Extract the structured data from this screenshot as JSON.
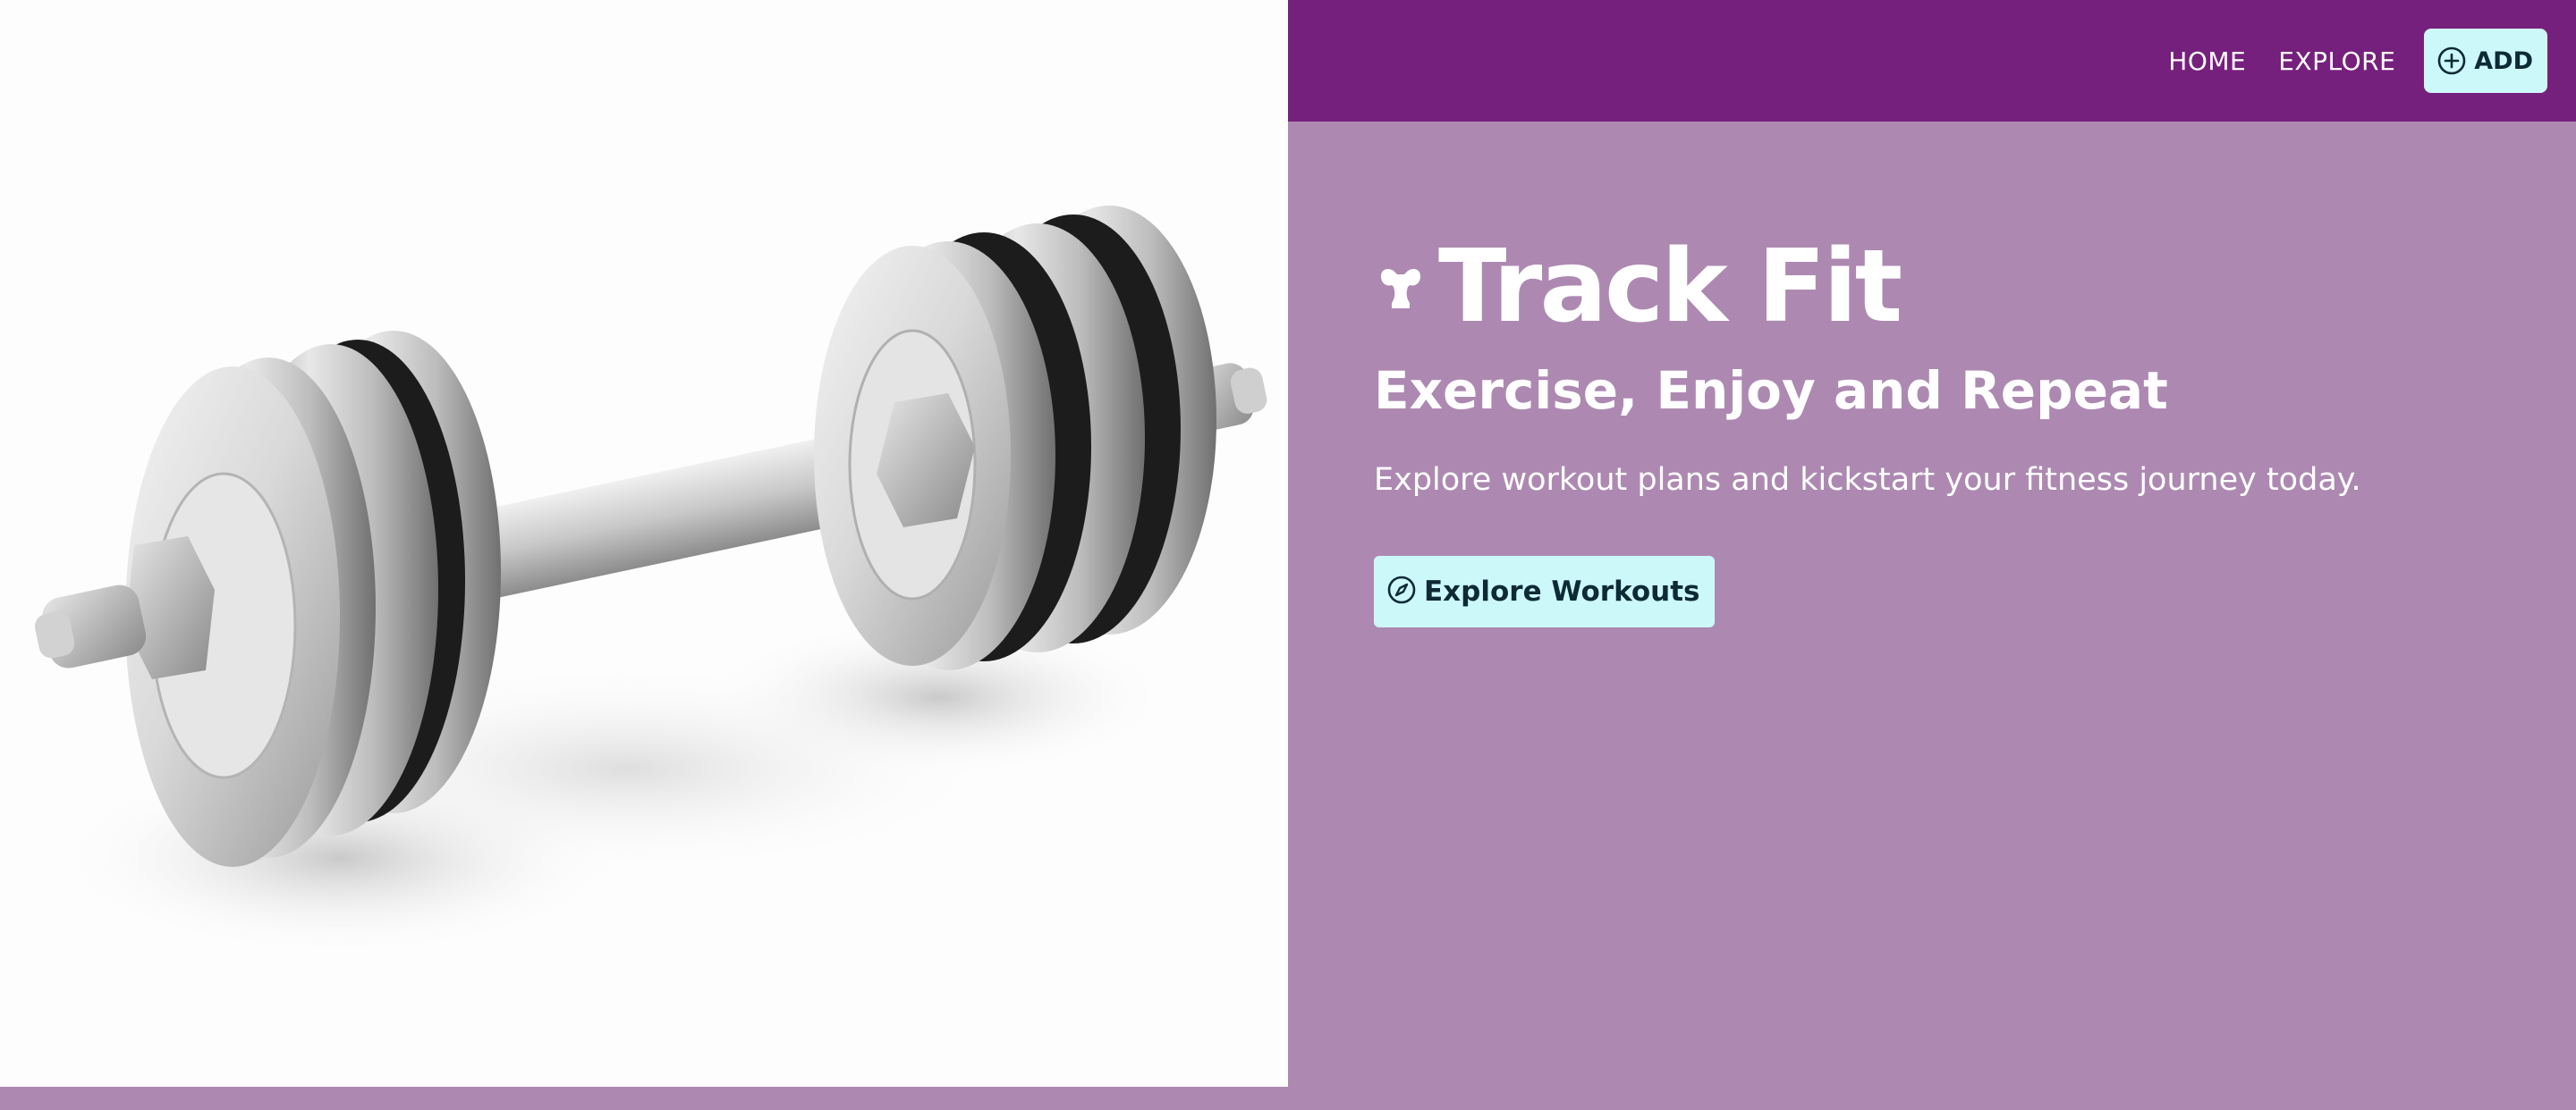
{
  "nav": {
    "home_label": "HOME",
    "explore_label": "EXPLORE",
    "add_label": "ADD",
    "add_icon": "plus-circle-icon"
  },
  "hero": {
    "brand_icon": "flexed-arm-icon",
    "title": "Track Fit",
    "tagline": "Exercise, Enjoy and Repeat",
    "subtitle": "Explore workout plans and kickstart your fitness journey today.",
    "cta_label": "Explore Workouts",
    "cta_icon": "compass-icon",
    "image_subject": "dumbbell"
  },
  "colors": {
    "topbar": "#76207d",
    "background": "#ad89b2",
    "button": "#cdf8fa",
    "button_text": "#0d2a35",
    "text": "#ffffff"
  }
}
